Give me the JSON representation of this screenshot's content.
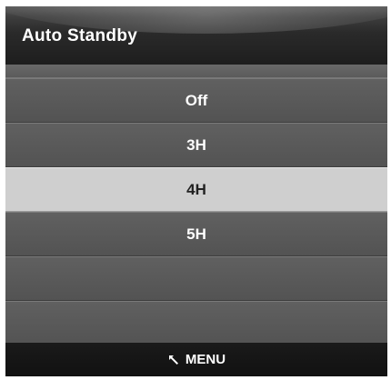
{
  "header": {
    "title": "Auto Standby"
  },
  "menu": {
    "items": [
      {
        "label": "Off",
        "selected": false
      },
      {
        "label": "3H",
        "selected": false
      },
      {
        "label": "4H",
        "selected": true
      },
      {
        "label": "5H",
        "selected": false
      },
      {
        "label": "",
        "selected": false
      },
      {
        "label": "",
        "selected": false
      }
    ]
  },
  "footer": {
    "icon": "return-arrow-icon",
    "label": "MENU"
  },
  "colors": {
    "background": "#3a3a3a",
    "row": "#5a5a5a",
    "selected_row": "#cfcfcf",
    "header": "#222222",
    "footer": "#151515"
  }
}
